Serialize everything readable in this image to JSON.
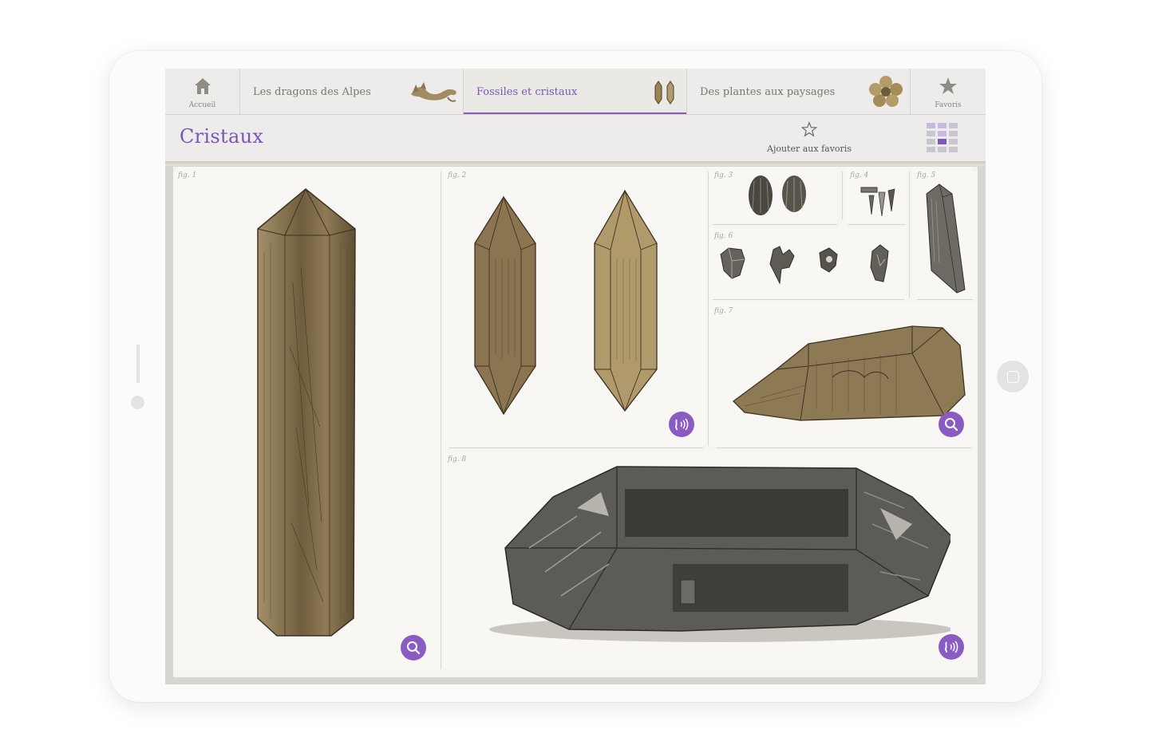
{
  "tabs": {
    "home_label": "Accueil",
    "items": [
      {
        "label": "Les dragons des Alpes"
      },
      {
        "label": "Fossiles et cristaux"
      },
      {
        "label": "Des plantes aux paysages"
      }
    ],
    "favorites_label": "Favoris"
  },
  "header": {
    "title": "Cristaux",
    "add_favorites_label": "Ajouter aux favoris"
  },
  "figures": {
    "fig1": "fig. 1",
    "fig2": "fig. 2",
    "fig3": "fig. 3",
    "fig4": "fig. 4",
    "fig5": "fig. 5",
    "fig6": "fig. 6",
    "fig7": "fig. 7",
    "fig8": "fig. 8"
  },
  "colors": {
    "accent": "#8a5cc2",
    "title": "#7b55b8"
  }
}
